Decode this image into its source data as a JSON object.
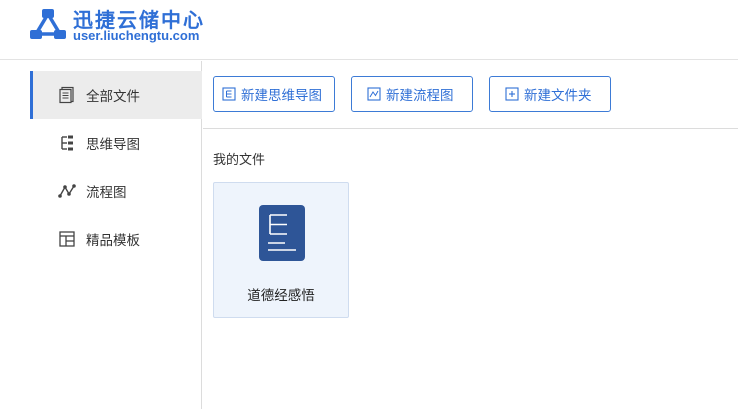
{
  "brand": {
    "title": "迅捷云储中心",
    "url": "user.liuchengtu.com",
    "logo_icon": "network-triangle-logo"
  },
  "sidebar": {
    "items": [
      {
        "label": "全部文件",
        "icon": "document-icon",
        "active": true
      },
      {
        "label": "思维导图",
        "icon": "mindmap-icon",
        "active": false
      },
      {
        "label": "流程图",
        "icon": "flowchart-icon",
        "active": false
      },
      {
        "label": "精品模板",
        "icon": "template-icon",
        "active": false
      }
    ]
  },
  "toolbar": {
    "new_mindmap": "新建思维导图",
    "new_flowchart": "新建流程图",
    "new_folder": "新建文件夹"
  },
  "main": {
    "section_title": "我的文件",
    "files": [
      {
        "name": "道德经感悟",
        "type": "mindmap"
      }
    ]
  },
  "colors": {
    "accent": "#2f6fd6",
    "file_icon": "#2e5597",
    "card_bg": "#eef4fc"
  }
}
